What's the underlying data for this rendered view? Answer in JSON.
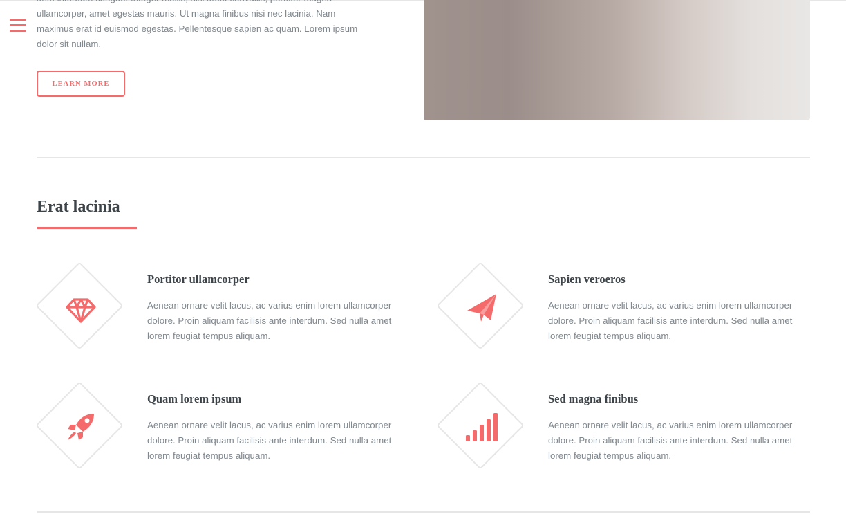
{
  "header": {
    "menu_icon": "hamburger-menu-icon"
  },
  "intro": {
    "text_line_1": "ante interdum congue. Integer mollis, nisl amet convallis, porttitor magna",
    "text_line_2": "ullamcorper, amet egestas mauris. Ut magna finibus nisi nec lacinia. Nam",
    "text_line_3": "maximus erat id euismod egestas. Pellentesque sapien ac quam. Lorem ipsum",
    "text_line_4": "dolor sit nullam.",
    "button_label": "LEARN MORE"
  },
  "features_section": {
    "title": "Erat lacinia",
    "accent_color": "#f56a6a",
    "items": [
      {
        "icon": "gem-icon",
        "title": "Portitor ullamcorper",
        "text": "Aenean ornare velit lacus, ac varius enim lorem ullamcorper dolore. Proin aliquam facilisis ante interdum. Sed nulla amet lorem feugiat tempus aliquam."
      },
      {
        "icon": "paper-plane-icon",
        "title": "Sapien veroeros",
        "text": "Aenean ornare velit lacus, ac varius enim lorem ullamcorper dolore. Proin aliquam facilisis ante interdum. Sed nulla amet lorem feugiat tempus aliquam."
      },
      {
        "icon": "rocket-icon",
        "title": "Quam lorem ipsum",
        "text": "Aenean ornare velit lacus, ac varius enim lorem ullamcorper dolore. Proin aliquam facilisis ante interdum. Sed nulla amet lorem feugiat tempus aliquam."
      },
      {
        "icon": "signal-icon",
        "title": "Sed magna finibus",
        "text": "Aenean ornare velit lacus, ac varius enim lorem ullamcorper dolore. Proin aliquam facilisis ante interdum. Sed nulla amet lorem feugiat tempus aliquam."
      }
    ]
  }
}
